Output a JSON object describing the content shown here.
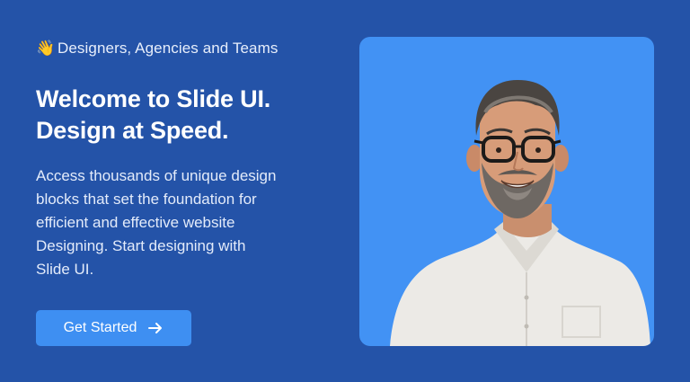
{
  "hero": {
    "eyebrow_emoji": "👋",
    "eyebrow_text": "Designers, Agencies and Teams",
    "headline_lines": [
      "Welcome to Slide UI.",
      "Design at Speed."
    ],
    "body_lines": [
      "Access thousands of unique design",
      "blocks that set the foundation for",
      "efficient and effective website",
      "Designing. Start designing with",
      "Slide UI."
    ],
    "cta_label": "Get Started",
    "cta_icon": "arrow-right-icon"
  },
  "photo": {
    "subject": "smiling-man-portrait-icon",
    "background_color": "#4292F4"
  },
  "colors": {
    "page_background": "#2453A8",
    "button": "#3E8FF2",
    "text": "#FFFFFF"
  }
}
